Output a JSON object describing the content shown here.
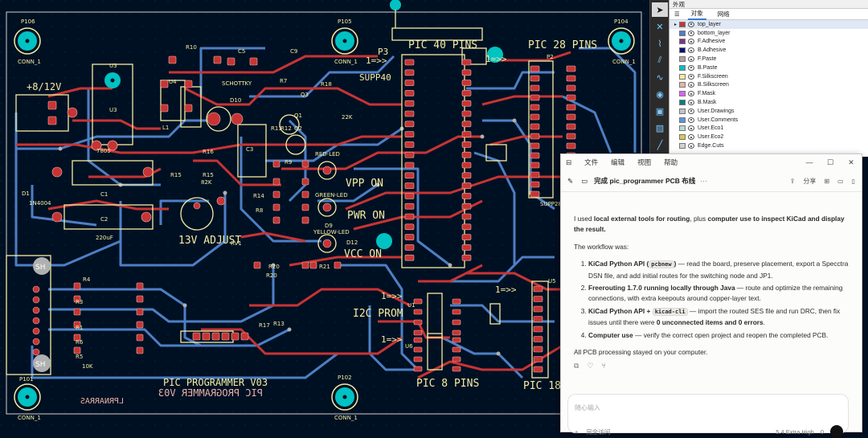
{
  "pcb": {
    "mount_holes": [
      {
        "ref": "P106",
        "label": "CONN_1"
      },
      {
        "ref": "P105",
        "label": "CONN_1"
      },
      {
        "ref": "P104",
        "label": "CONN_1"
      },
      {
        "ref": "P101",
        "label": "CONN_1"
      },
      {
        "ref": "P102",
        "label": "CONN_1"
      }
    ],
    "texts": {
      "pic40": "PIC 40 PINS",
      "pic28": "PIC 28 PINS",
      "pic8": "PIC 8 PINS",
      "pic18": "PIC 18",
      "supp40": "SUPP40",
      "p3": "P3",
      "arrow": "1=>>",
      "v812": "+8/12V",
      "vpp_on": "VPP ON",
      "pwr_on": "PWR ON",
      "vcc_on": "VCC ON",
      "adj13v": "13V ADJUST",
      "i2c_prom": "I2C PROM",
      "prog_v03": "PIC PROGRAMMER V03",
      "prog_v03_mirror": "PIC PROGRAMMER V03",
      "sh": "SH",
      "r10": "R10",
      "c5": "C5",
      "c9": "C9",
      "u3": "U3",
      "u4": "U4",
      "d10": "D10",
      "schottky": "SCHOTTKY",
      "l1": "L1",
      "c3": "C3",
      "r16": "R16",
      "r15": "R15",
      "c1": "C1",
      "c2": "C2",
      "uf220": "220uF",
      "d1": "D1",
      "n4004": "1N4004",
      "rv1": "RV1",
      "r9": "R9",
      "r8": "R8",
      "r14": "R14",
      "r20": "R20",
      "r21": "R21",
      "r4": "R4",
      "r3": "R3",
      "r1": "R1",
      "r6": "R6",
      "r5": "R5",
      "k10": "10K",
      "d12": "D12",
      "d9": "D9",
      "red_led": "RED-LED",
      "green_led": "GREEN-LED",
      "yellow_led": "YELLOW-LED",
      "u1": "U1",
      "u6": "U6",
      "u5": "U5",
      "p2": "P2",
      "supp28": "SUPP28",
      "k22": "22K",
      "q1": "Q1",
      "q2": "Q2",
      "q3": "Q3",
      "r7": "R7",
      "r18": "R18",
      "r11": "R11",
      "r12": "R12",
      "r13": "R13",
      "r17": "R17",
      "u7805": "7805",
      "k82": "82K",
      "mirror_name": "LPRNARRAS"
    }
  },
  "toolbar": [
    "cursor",
    "close-x",
    "route-track",
    "route-diff",
    "tune-length",
    "via",
    "zone",
    "rule-area",
    "graphic-line"
  ],
  "appearance": {
    "title": "外观",
    "tabs": [
      "对象",
      "网络"
    ],
    "layers": [
      {
        "name": "top_layer",
        "color": "#c83434",
        "active": true
      },
      {
        "name": "bottom_layer",
        "color": "#4d7fc4"
      },
      {
        "name": "F.Adhesive",
        "color": "#843184"
      },
      {
        "name": "B.Adhesive",
        "color": "#0b0f7a"
      },
      {
        "name": "F.Paste",
        "color": "#b4a0a0"
      },
      {
        "name": "B.Paste",
        "color": "#00c2c2"
      },
      {
        "name": "F.Silkscreen",
        "color": "#f2eda1"
      },
      {
        "name": "B.Silkscreen",
        "color": "#e8b2a7"
      },
      {
        "name": "F.Mask",
        "color": "#d864ff"
      },
      {
        "name": "B.Mask",
        "color": "#027f7f"
      },
      {
        "name": "User.Drawings",
        "color": "#c2c2c2"
      },
      {
        "name": "User.Comments",
        "color": "#5994dc"
      },
      {
        "name": "User.Eco1",
        "color": "#b4dbd2"
      },
      {
        "name": "User.Eco2",
        "color": "#d8c852"
      },
      {
        "name": "Edge.Cuts",
        "color": "#d0d2cd"
      }
    ]
  },
  "chat": {
    "menu": [
      "文件",
      "编辑",
      "视图",
      "帮助"
    ],
    "title": "完成 pic_programmer PCB 布线",
    "share": "分享",
    "intro_a": "I used ",
    "intro_b1": "local external tools for routing",
    "intro_c": ", plus ",
    "intro_b2": "computer use to inspect KiCad and display the result.",
    "workflow": "The workflow was:",
    "steps": [
      {
        "bold": "KiCad Python API (",
        "code": "pcbnew",
        "bold2": ")",
        "rest": " — read the board, preserve placement, export a Specctra DSN file, and add initial routes for the switching node and JP1."
      },
      {
        "bold": "Freerouting 1.7.0 running locally through Java",
        "code": "",
        "bold2": "",
        "rest": " — route and optimize the remaining connections, with extra keepouts around copper-layer text."
      },
      {
        "bold": "KiCad Python API + ",
        "code": "kicad-cli",
        "bold2": "",
        "rest": " — import the routed SES file and run DRC, then fix issues until there were ",
        "bold3": "0 unconnected items and 0 errors",
        "rest2": "."
      },
      {
        "bold": "Computer use",
        "code": "",
        "bold2": "",
        "rest": " — verify the correct open project and reopen the completed PCB."
      }
    ],
    "closing": "All PCB processing stayed on your computer.",
    "composer_placeholder": "随心输入",
    "composer_left": "完全访问",
    "composer_model": "5.4 Extra High",
    "composer_mic": "0"
  }
}
